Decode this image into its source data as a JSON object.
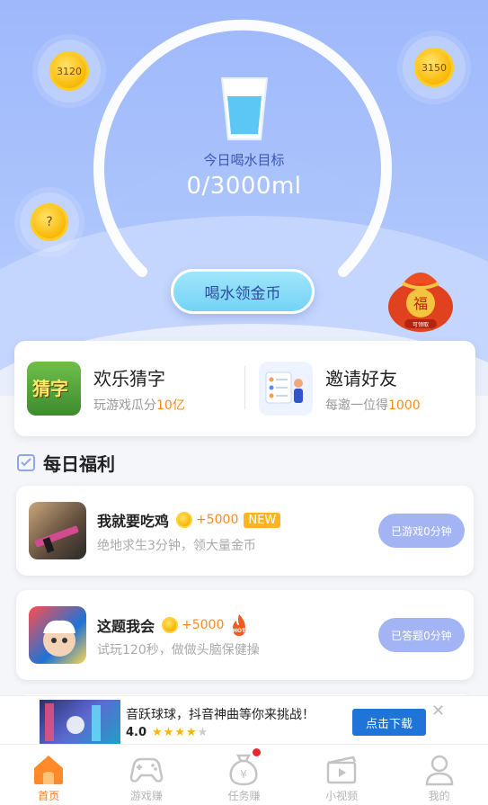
{
  "hero": {
    "goal_title": "今日喝水目标",
    "goal_value": "0/3000ml",
    "drink_button": "喝水领金币",
    "coins": [
      "3120",
      "3150",
      "?"
    ],
    "bag_label": "可领取"
  },
  "shortcuts": [
    {
      "title": "欢乐猜字",
      "sub_prefix": "玩游戏瓜分",
      "sub_highlight": "10亿",
      "icon_text": "猜字"
    },
    {
      "title": "邀请好友",
      "sub_prefix": "每邀一位得",
      "sub_highlight": "1000"
    }
  ],
  "section": {
    "title": "每日福利"
  },
  "tasks": [
    {
      "name": "我就要吃鸡",
      "reward": "+5000",
      "badge": "NEW",
      "desc": "绝地求生3分钟，领大量金币",
      "button": "已游戏0分钟"
    },
    {
      "name": "这题我会",
      "reward": "+5000",
      "badge": "HOT",
      "desc": "试玩120秒，做做头脑保健操",
      "button": "已答题0分钟"
    }
  ],
  "ad": {
    "title": "音跃球球，抖音神曲等你来挑战！",
    "rating": "4.0",
    "stars_on": "★★★★",
    "stars_off": "★",
    "button": "点击下载",
    "close": "✕"
  },
  "tabs": [
    {
      "label": "首页",
      "icon": "home-icon",
      "active": true
    },
    {
      "label": "游戏赚",
      "icon": "gamepad-icon"
    },
    {
      "label": "任务赚",
      "icon": "money-bag-icon"
    },
    {
      "label": "小视频",
      "icon": "video-icon"
    },
    {
      "label": "我的",
      "icon": "profile-icon"
    }
  ],
  "colors": {
    "accent": "#ff7a1e",
    "hero_bg": "#a9c2fc",
    "button_blue": "#a3b4f5",
    "reward": "#ff8a1a"
  }
}
